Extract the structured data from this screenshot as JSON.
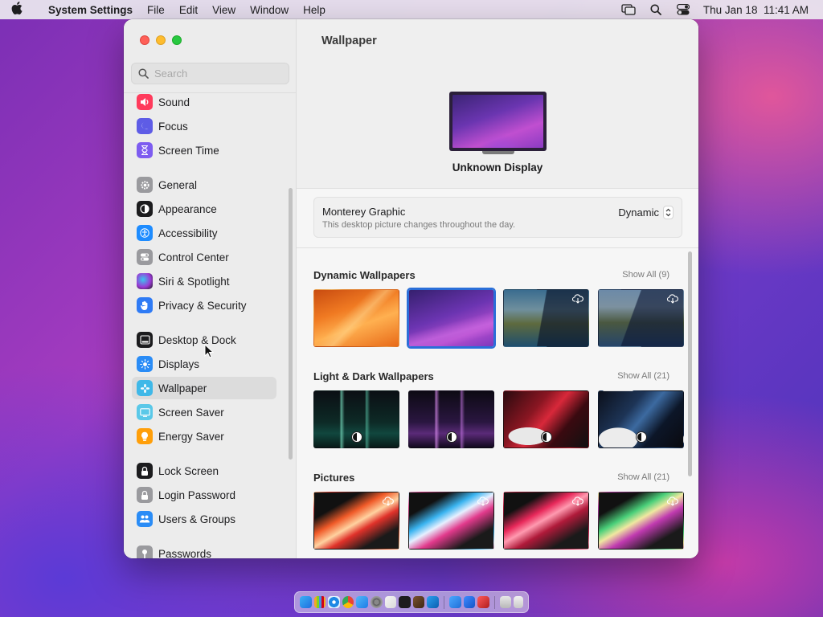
{
  "menubar": {
    "app_name": "System Settings",
    "menus": [
      "File",
      "Edit",
      "View",
      "Window",
      "Help"
    ],
    "datetime": "Thu Jan 18  11:41 AM"
  },
  "sidebar": {
    "search_placeholder": "Search",
    "items": [
      {
        "label": "Sound",
        "icon": "speaker-icon",
        "color": "#ff3b5c"
      },
      {
        "label": "Focus",
        "icon": "moon-icon",
        "color": "#5e5ce6"
      },
      {
        "label": "Screen Time",
        "icon": "hourglass-icon",
        "color": "#7d5cf0"
      },
      {
        "label": "General",
        "icon": "gear-icon",
        "color": "#9a9a9e"
      },
      {
        "label": "Appearance",
        "icon": "contrast-icon",
        "color": "#1c1c1e"
      },
      {
        "label": "Accessibility",
        "icon": "accessibility-icon",
        "color": "#1e8cff"
      },
      {
        "label": "Control Center",
        "icon": "toggles-icon",
        "color": "#9a9a9e"
      },
      {
        "label": "Siri & Spotlight",
        "icon": "siri-icon",
        "color": "#d2399a"
      },
      {
        "label": "Privacy & Security",
        "icon": "hand-icon",
        "color": "#2f7bf5"
      },
      {
        "label": "Desktop & Dock",
        "icon": "dock-icon",
        "color": "#1c1c1e"
      },
      {
        "label": "Displays",
        "icon": "sun-icon",
        "color": "#2a8cf6"
      },
      {
        "label": "Wallpaper",
        "icon": "flower-icon",
        "color": "#3fb8e8"
      },
      {
        "label": "Screen Saver",
        "icon": "screensaver-icon",
        "color": "#5ac8e8"
      },
      {
        "label": "Energy Saver",
        "icon": "bulb-icon",
        "color": "#ff9f0a"
      },
      {
        "label": "Lock Screen",
        "icon": "lock-icon",
        "color": "#1c1c1e"
      },
      {
        "label": "Login Password",
        "icon": "padlock-icon",
        "color": "#9a9a9e"
      },
      {
        "label": "Users & Groups",
        "icon": "users-icon",
        "color": "#2a8cf6"
      },
      {
        "label": "Passwords",
        "icon": "key-icon",
        "color": "#9a9a9e"
      }
    ],
    "selected": "Wallpaper"
  },
  "main": {
    "title": "Wallpaper",
    "display_name": "Unknown Display",
    "current": {
      "name": "Monterey Graphic",
      "description": "This desktop picture changes throughout the day.",
      "mode": "Dynamic"
    },
    "sections": [
      {
        "title": "Dynamic Wallpapers",
        "show_all": "Show All (9)"
      },
      {
        "title": "Light & Dark Wallpapers",
        "show_all": "Show All (21)"
      },
      {
        "title": "Pictures",
        "show_all": "Show All (21)"
      }
    ]
  },
  "colors": {
    "accent": "#2a6ed8",
    "close": "#fe5f57",
    "minimize": "#febc2e",
    "maximize": "#28c840"
  }
}
